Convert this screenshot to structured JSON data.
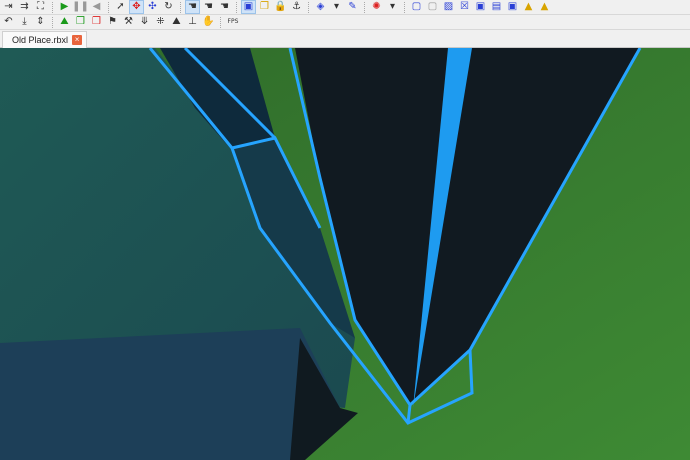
{
  "toolbar_row1": [
    {
      "icon": "step-icon",
      "cls": "dark",
      "g": "⇥"
    },
    {
      "icon": "step-over-icon",
      "cls": "dark",
      "g": "⇉"
    },
    {
      "icon": "fit-icon",
      "cls": "dark",
      "g": "⛶"
    },
    {
      "sep": true
    },
    {
      "icon": "play-icon",
      "cls": "green",
      "g": "▶"
    },
    {
      "icon": "pause-icon",
      "cls": "gray",
      "g": "❚❚"
    },
    {
      "icon": "step-back-icon",
      "cls": "gray",
      "g": "◀"
    },
    {
      "sep": true
    },
    {
      "icon": "select-icon",
      "cls": "dark",
      "g": "➚"
    },
    {
      "icon": "move-icon",
      "cls": "red",
      "g": "✥",
      "on": true
    },
    {
      "icon": "scale-icon",
      "cls": "blue",
      "g": "✣"
    },
    {
      "icon": "rotate-icon",
      "cls": "dark",
      "g": "↻"
    },
    {
      "sep": true
    },
    {
      "icon": "drag-icon",
      "cls": "dark",
      "g": "☚",
      "on": true
    },
    {
      "icon": "resize-icon",
      "cls": "dark",
      "g": "☚"
    },
    {
      "icon": "rotate-tool-icon",
      "cls": "dark",
      "g": "☚"
    },
    {
      "sep": true
    },
    {
      "icon": "collisions-icon",
      "cls": "blue",
      "g": "▣",
      "on": true
    },
    {
      "icon": "group-icon",
      "cls": "gold",
      "g": "❐"
    },
    {
      "icon": "lock-icon",
      "cls": "gold",
      "g": "🔒"
    },
    {
      "icon": "anchor-icon",
      "cls": "dark",
      "g": "⚓"
    },
    {
      "sep": true
    },
    {
      "icon": "paint-bucket-icon",
      "cls": "blue",
      "g": "◈"
    },
    {
      "icon": "dropdown-icon",
      "cls": "dark",
      "g": "▾"
    },
    {
      "icon": "color-picker-icon",
      "cls": "blue",
      "g": "✎"
    },
    {
      "sep": true
    },
    {
      "icon": "material-icon",
      "cls": "red",
      "g": "✺"
    },
    {
      "icon": "dropdown-icon",
      "cls": "dark",
      "g": "▾"
    },
    {
      "sep": true
    },
    {
      "icon": "surface-smooth-icon",
      "cls": "blue",
      "g": "▢"
    },
    {
      "icon": "surface-glue-icon",
      "cls": "gray",
      "g": "▢"
    },
    {
      "icon": "surface-weld-icon",
      "cls": "blue",
      "g": "▨"
    },
    {
      "icon": "surface-studs-icon",
      "cls": "blue",
      "g": "☒"
    },
    {
      "icon": "surface-inlet-icon",
      "cls": "blue",
      "g": "▣"
    },
    {
      "icon": "surface-universal-icon",
      "cls": "blue",
      "g": "▤"
    },
    {
      "icon": "surface-hinge-icon",
      "cls": "blue",
      "g": "▣"
    },
    {
      "icon": "surface-motor-icon",
      "cls": "gold",
      "g": "▲"
    },
    {
      "icon": "surface-stepping-icon",
      "cls": "gold",
      "g": "▲"
    }
  ],
  "toolbar_row2": [
    {
      "icon": "undo-icon",
      "cls": "dark",
      "g": "↶"
    },
    {
      "icon": "drop-icon",
      "cls": "dark",
      "g": "⤓"
    },
    {
      "icon": "lift-icon",
      "cls": "dark",
      "g": "⇕"
    },
    {
      "sep": true
    },
    {
      "icon": "insert-part-icon",
      "cls": "green",
      "g": "⛰"
    },
    {
      "icon": "insert-model-icon",
      "cls": "green",
      "g": "❒"
    },
    {
      "icon": "delete-model-icon",
      "cls": "red",
      "g": "❒"
    },
    {
      "icon": "flag-icon",
      "cls": "dark",
      "g": "⚑"
    },
    {
      "icon": "hammer-icon",
      "cls": "dark",
      "g": "⚒"
    },
    {
      "icon": "anchor-down-icon",
      "cls": "dark",
      "g": "⤋"
    },
    {
      "icon": "grid-icon",
      "cls": "dark",
      "g": "⁜"
    },
    {
      "icon": "terrain-icon",
      "cls": "dark",
      "g": "⛰"
    },
    {
      "icon": "stamp-icon",
      "cls": "dark",
      "g": "⊥"
    },
    {
      "icon": "glove-icon",
      "cls": "dark",
      "g": "✋"
    },
    {
      "sep": true
    },
    {
      "icon": "fps-icon",
      "cls": "dark",
      "g": "FPS"
    }
  ],
  "tab": {
    "label": "Old Place.rbxl",
    "close": "×"
  }
}
